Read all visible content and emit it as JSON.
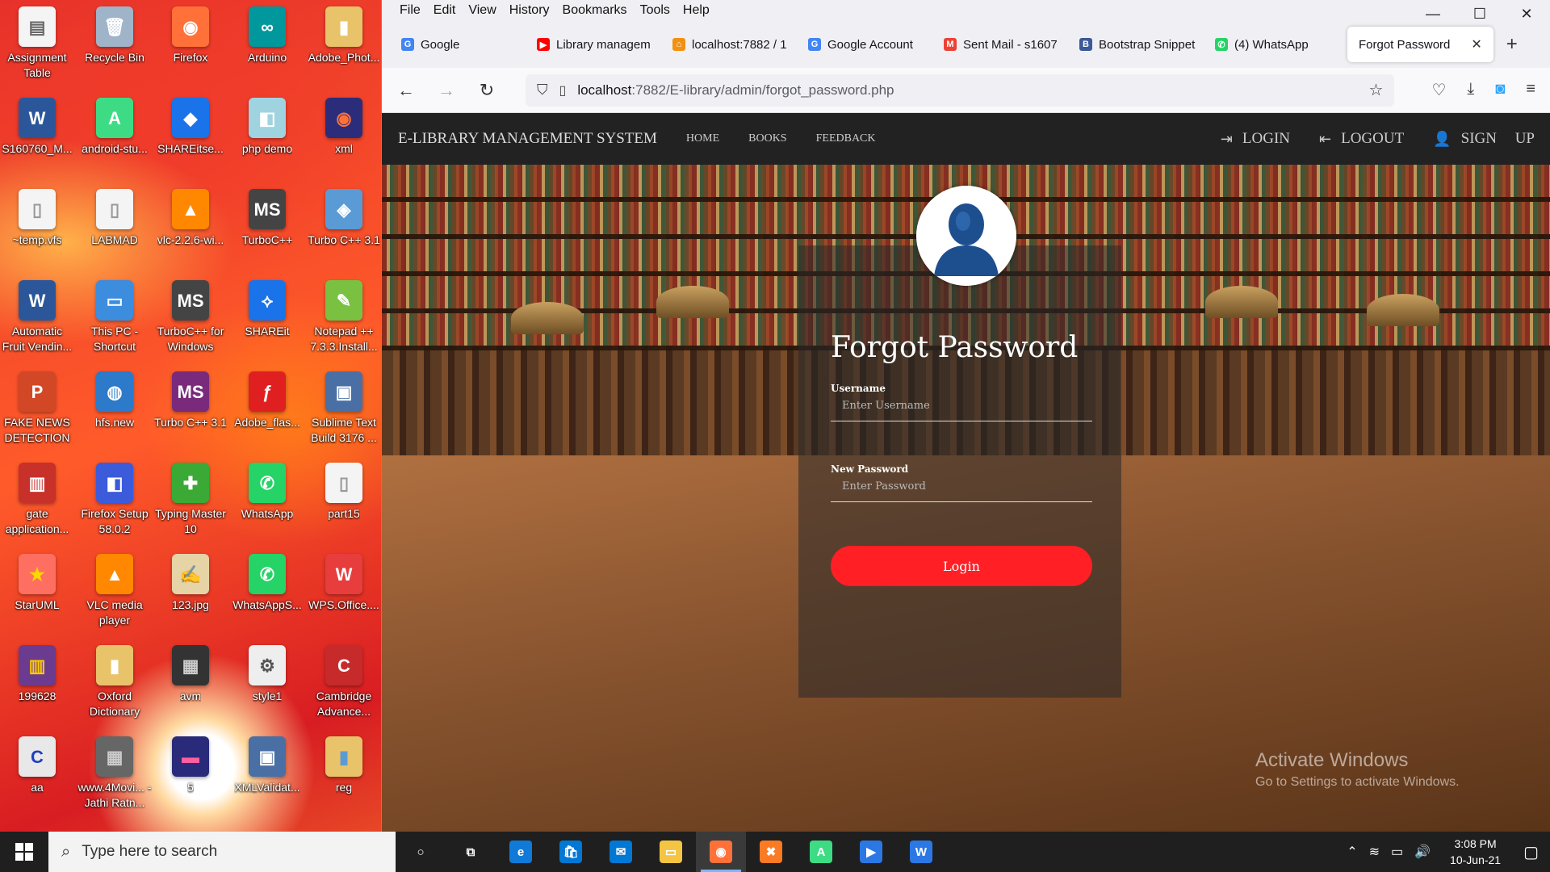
{
  "desktop": {
    "icons": [
      {
        "label": "Assignment Table",
        "color": "#f4f4f4",
        "glyph": "▤",
        "glyph_color": "#666"
      },
      {
        "label": "Recycle Bin",
        "color": "#9fb4c9",
        "glyph": "🗑",
        "glyph_color": "#fff"
      },
      {
        "label": "Firefox",
        "color": "#ff7139",
        "glyph": "◉",
        "glyph_color": "#fff"
      },
      {
        "label": "Arduino",
        "color": "#00979d",
        "glyph": "∞",
        "glyph_color": "#fff"
      },
      {
        "label": "Adobe_Phot...",
        "color": "#e8c36a",
        "glyph": "▮",
        "glyph_color": "#fff"
      },
      {
        "label": "S160760_M...",
        "color": "#2b579a",
        "glyph": "W",
        "glyph_color": "#fff"
      },
      {
        "label": "android-stu...",
        "color": "#3ddc84",
        "glyph": "A",
        "glyph_color": "#fff"
      },
      {
        "label": "SHAREitse...",
        "color": "#1a73e8",
        "glyph": "◆",
        "glyph_color": "#fff"
      },
      {
        "label": "php demo",
        "color": "#9fd3e0",
        "glyph": "◧",
        "glyph_color": "#fff"
      },
      {
        "label": "xml",
        "color": "#2b2d7a",
        "glyph": "◉",
        "glyph_color": "#ff7139"
      },
      {
        "label": "~temp.vfs",
        "color": "#f4f4f4",
        "glyph": "▯",
        "glyph_color": "#999"
      },
      {
        "label": "LABMAD",
        "color": "#f4f4f4",
        "glyph": "▯",
        "glyph_color": "#999"
      },
      {
        "label": "vlc-2.2.6-wi...",
        "color": "#ff8800",
        "glyph": "▲",
        "glyph_color": "#fff"
      },
      {
        "label": "TurboC++",
        "color": "#444",
        "glyph": "MS",
        "glyph_color": "#fff"
      },
      {
        "label": "Turbo C++ 3.1",
        "color": "#5b9bd5",
        "glyph": "◈",
        "glyph_color": "#fff"
      },
      {
        "label": "Automatic Fruit Vendin...",
        "color": "#2b579a",
        "glyph": "W",
        "glyph_color": "#fff"
      },
      {
        "label": "This PC - Shortcut",
        "color": "#3c8dde",
        "glyph": "▭",
        "glyph_color": "#fff"
      },
      {
        "label": "TurboC++ for Windows",
        "color": "#444",
        "glyph": "MS",
        "glyph_color": "#fff"
      },
      {
        "label": "SHAREit",
        "color": "#1a73e8",
        "glyph": "⟡",
        "glyph_color": "#fff"
      },
      {
        "label": "Notepad ++ 7.3.3.Install...",
        "color": "#7ac142",
        "glyph": "✎",
        "glyph_color": "#fff"
      },
      {
        "label": "FAKE NEWS DETECTION",
        "color": "#d24726",
        "glyph": "P",
        "glyph_color": "#fff"
      },
      {
        "label": "hfs.new",
        "color": "#2c7ac9",
        "glyph": "◍",
        "glyph_color": "#fff"
      },
      {
        "label": "Turbo C++ 3.1",
        "color": "#7a2a7a",
        "glyph": "MS",
        "glyph_color": "#fff"
      },
      {
        "label": "Adobe_flas...",
        "color": "#e02020",
        "glyph": "ƒ",
        "glyph_color": "#fff"
      },
      {
        "label": "Sublime Text Build 3176 ...",
        "color": "#4a6fa5",
        "glyph": "▣",
        "glyph_color": "#fff"
      },
      {
        "label": "gate application...",
        "color": "#c8302a",
        "glyph": "▥",
        "glyph_color": "#fff"
      },
      {
        "label": "Firefox Setup 58.0.2",
        "color": "#3b5bdb",
        "glyph": "◧",
        "glyph_color": "#fff"
      },
      {
        "label": "Typing Master 10",
        "color": "#3aa935",
        "glyph": "✚",
        "glyph_color": "#fff"
      },
      {
        "label": "WhatsApp",
        "color": "#25d366",
        "glyph": "✆",
        "glyph_color": "#fff"
      },
      {
        "label": "part15",
        "color": "#f4f4f4",
        "glyph": "▯",
        "glyph_color": "#999"
      },
      {
        "label": "StarUML",
        "color": "#ff6f61",
        "glyph": "★",
        "glyph_color": "#ffd700"
      },
      {
        "label": "VLC media player",
        "color": "#ff8800",
        "glyph": "▲",
        "glyph_color": "#fff"
      },
      {
        "label": "123.jpg",
        "color": "#e6d3a6",
        "glyph": "✍",
        "glyph_color": "#555"
      },
      {
        "label": "WhatsAppS...",
        "color": "#25d366",
        "glyph": "✆",
        "glyph_color": "#fff"
      },
      {
        "label": "WPS.Office....",
        "color": "#e83d3d",
        "glyph": "W",
        "glyph_color": "#fff"
      },
      {
        "label": "199628",
        "color": "#6a3b8f",
        "glyph": "▥",
        "glyph_color": "#ffcc00"
      },
      {
        "label": "Oxford Dictionary",
        "color": "#e8c36a",
        "glyph": "▮",
        "glyph_color": "#fff"
      },
      {
        "label": "avm",
        "color": "#333",
        "glyph": "▦",
        "glyph_color": "#ccc"
      },
      {
        "label": "style1",
        "color": "#eee",
        "glyph": "⚙",
        "glyph_color": "#555"
      },
      {
        "label": "Cambridge Advance...",
        "color": "#c72a2a",
        "glyph": "C",
        "glyph_color": "#fff"
      },
      {
        "label": "aa",
        "color": "#e8e8e8",
        "glyph": "C",
        "glyph_color": "#1f3fbf"
      },
      {
        "label": "www.4Movi... - Jathi Ratn...",
        "color": "#666",
        "glyph": "▦",
        "glyph_color": "#ccc"
      },
      {
        "label": "5",
        "color": "#2a2a7a",
        "glyph": "▬",
        "glyph_color": "#ff5fa0"
      },
      {
        "label": "XMLValidat...",
        "color": "#4a6fa5",
        "glyph": "▣",
        "glyph_color": "#fff"
      },
      {
        "label": "reg",
        "color": "#e8c36a",
        "glyph": "▮",
        "glyph_color": "#5b9bd5"
      }
    ]
  },
  "browser": {
    "menu": [
      "File",
      "Edit",
      "View",
      "History",
      "Bookmarks",
      "Tools",
      "Help"
    ],
    "tabs": [
      {
        "label": "Google",
        "favicon": "G",
        "color": "#4285f4"
      },
      {
        "label": "Library managem",
        "favicon": "▶",
        "color": "#ff0000"
      },
      {
        "label": "localhost:7882 / 1",
        "favicon": "⌂",
        "color": "#f29111"
      },
      {
        "label": "Google Account",
        "favicon": "G",
        "color": "#4285f4"
      },
      {
        "label": "Sent Mail - s1607",
        "favicon": "M",
        "color": "#ea4335"
      },
      {
        "label": "Bootstrap Snippet",
        "favicon": "B",
        "color": "#3b5998"
      },
      {
        "label": "(4) WhatsApp",
        "favicon": "✆",
        "color": "#25d366"
      }
    ],
    "active_tab": {
      "label": "Forgot Password",
      "close": "✕"
    },
    "new_tab": "+",
    "url_host": "localhost",
    "url_path": ":7882/E-library/admin/forgot_password.php",
    "window_controls": [
      "—",
      "☐",
      "✕"
    ]
  },
  "site": {
    "brand": "E-LIBRARY MANAGEMENT SYSTEM",
    "nav": [
      "HOME",
      "BOOKS",
      "FEEDBACK"
    ],
    "right": {
      "login": "LOGIN",
      "logout": "LOGOUT",
      "signup": "SIGN UP"
    },
    "form": {
      "title": "Forgot Password",
      "username_label": "Username",
      "username_placeholder": "Enter Username",
      "password_label": "New Password",
      "password_placeholder": "Enter Password",
      "submit": "Login"
    },
    "watermark": {
      "line1": "Activate Windows",
      "line2": "Go to Settings to activate Windows."
    }
  },
  "taskbar": {
    "search_placeholder": "Type here to search",
    "apps": [
      {
        "name": "cortana",
        "glyph": "○",
        "color": "transparent"
      },
      {
        "name": "task-view",
        "glyph": "⧉",
        "color": "transparent"
      },
      {
        "name": "edge",
        "glyph": "e",
        "color": "#0f7ad8"
      },
      {
        "name": "store",
        "glyph": "🛍",
        "color": "#0078d4"
      },
      {
        "name": "mail",
        "glyph": "✉",
        "color": "#0078d4"
      },
      {
        "name": "file-explorer",
        "glyph": "▭",
        "color": "#f4c542"
      },
      {
        "name": "firefox",
        "glyph": "◉",
        "color": "#ff7139",
        "active": true
      },
      {
        "name": "xampp",
        "glyph": "✖",
        "color": "#fb7a24"
      },
      {
        "name": "android-studio",
        "glyph": "A",
        "color": "#3ddc84"
      },
      {
        "name": "media",
        "glyph": "▶",
        "color": "#2b78e4"
      },
      {
        "name": "wps",
        "glyph": "W",
        "color": "#2b78e4"
      }
    ],
    "time": "3:08 PM",
    "date": "10-Jun-21"
  }
}
